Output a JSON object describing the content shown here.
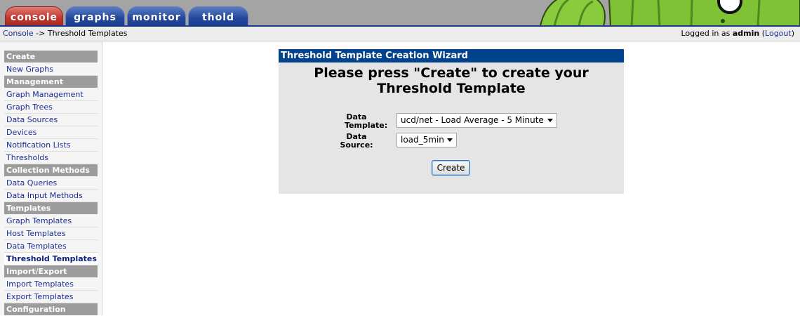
{
  "tabs": [
    {
      "label": "console",
      "active": true
    },
    {
      "label": "graphs",
      "active": false
    },
    {
      "label": "monitor",
      "active": false
    },
    {
      "label": "thold",
      "active": false
    }
  ],
  "breadcrumb": {
    "console": "Console",
    "separator": " -> ",
    "current": "Threshold Templates"
  },
  "login": {
    "prefix": "Logged in as ",
    "user": "admin",
    "logout": "Logout"
  },
  "sidebar": {
    "sections": [
      {
        "header": "Create",
        "items": [
          "New Graphs"
        ]
      },
      {
        "header": "Management",
        "items": [
          "Graph Management",
          "Graph Trees",
          "Data Sources",
          "Devices",
          "Notification Lists",
          "Thresholds"
        ]
      },
      {
        "header": "Collection Methods",
        "items": [
          "Data Queries",
          "Data Input Methods"
        ]
      },
      {
        "header": "Templates",
        "items": [
          "Graph Templates",
          "Host Templates",
          "Data Templates",
          "Threshold Templates"
        ]
      },
      {
        "header": "Import/Export",
        "items": [
          "Import Templates",
          "Export Templates"
        ]
      },
      {
        "header": "Configuration",
        "items": []
      }
    ],
    "selected": "Threshold Templates"
  },
  "wizard": {
    "title": "Threshold Template Creation Wizard",
    "heading": "Please press \"Create\" to create your Threshold Template",
    "data_template_label_1": "Data",
    "data_template_label_2": "Template:",
    "data_template_value": "ucd/net - Load Average - 5 Minute",
    "data_source_label_1": "Data",
    "data_source_label_2": "Source:",
    "data_source_value": "load_5min",
    "create_label": "Create"
  },
  "colors": {
    "header_blue": "#00438c",
    "tab_blue": "#24479a",
    "tab_red": "#c1352c",
    "menu_header": "#9c9c9c"
  }
}
